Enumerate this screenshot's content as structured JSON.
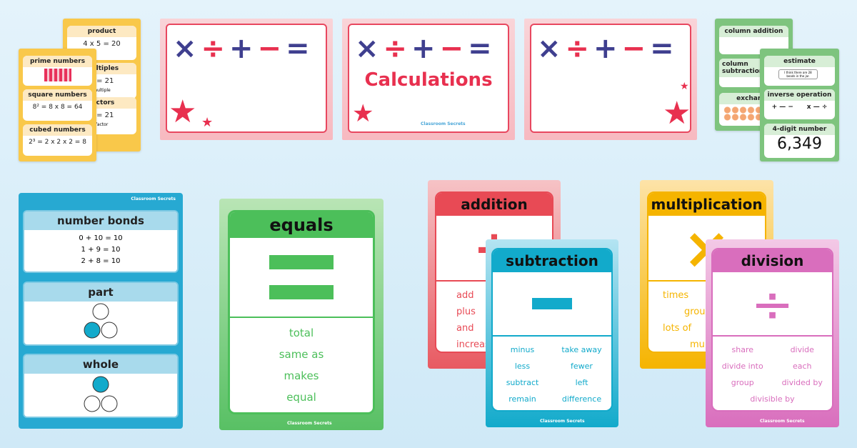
{
  "yellow_back": {
    "sections": [
      {
        "title": "product",
        "body": "4 x 5 = 20"
      },
      {
        "title": "multiples",
        "body": "7 = 21",
        "note": "multiple"
      },
      {
        "title": "factors",
        "body": "7 = 21",
        "note": "factor"
      }
    ]
  },
  "yellow_front": {
    "sections": [
      {
        "title": "prime numbers",
        "body": ""
      },
      {
        "title": "square numbers",
        "body": "8² = 8 x 8 = 64"
      },
      {
        "title": "cubed numbers",
        "body": "2³ = 2 x 2 x 2 = 8"
      }
    ]
  },
  "banners": [
    {
      "ops": [
        "×",
        "÷",
        "+",
        "−",
        "="
      ],
      "title": ""
    },
    {
      "ops": [
        "×",
        "÷",
        "+",
        "−",
        "="
      ],
      "title": "Calculations",
      "logo": "Classroom Secrets"
    },
    {
      "ops": [
        "×",
        "÷",
        "+",
        "−",
        "="
      ],
      "title": ""
    }
  ],
  "green_back": {
    "sections": [
      {
        "title": "column addition"
      },
      {
        "title": "column subtraction"
      },
      {
        "title": "exchange"
      }
    ]
  },
  "green_front": {
    "sections": [
      {
        "title": "estimate",
        "body": "I think there are 28 beads in the jar."
      },
      {
        "title": "inverse operation",
        "body": "+ — −      x — ÷"
      },
      {
        "title": "4-digit number",
        "body": "6,349"
      }
    ]
  },
  "bonds": {
    "logo": "Classroom Secrets",
    "sections": [
      {
        "title": "number bonds",
        "lines": [
          "0 + 10 = 10",
          "1 + 9 = 10",
          "2 + 8 = 10"
        ]
      },
      {
        "title": "part"
      },
      {
        "title": "whole"
      }
    ],
    "color": "#1ea7cf"
  },
  "equals": {
    "title": "equals",
    "symbol": "=",
    "words": [
      "total",
      "same as",
      "makes",
      "equal"
    ],
    "logo": "Classroom Secrets",
    "color": "#4cbf5a"
  },
  "addition": {
    "title": "addition",
    "symbol": "+",
    "words": [
      "add",
      "plus",
      "and",
      "increase"
    ],
    "color": "#e84a55"
  },
  "subtraction": {
    "title": "subtraction",
    "symbol": "−",
    "words": [
      "minus",
      "take away",
      "less",
      "fewer",
      "subtract",
      "left",
      "remain",
      "difference"
    ],
    "logo": "Classroom Secrets",
    "color": "#12aacb"
  },
  "multiplication": {
    "title": "multiplication",
    "symbol": "×",
    "words": [
      "times",
      "groups",
      "lots of",
      "multiply"
    ],
    "color": "#f5b400"
  },
  "division": {
    "title": "division",
    "symbol": "÷",
    "words": [
      "share",
      "divide",
      "divide into",
      "each",
      "group",
      "divided by",
      "divisible by"
    ],
    "logo": "Classroom Secrets",
    "color": "#d96ebd"
  }
}
